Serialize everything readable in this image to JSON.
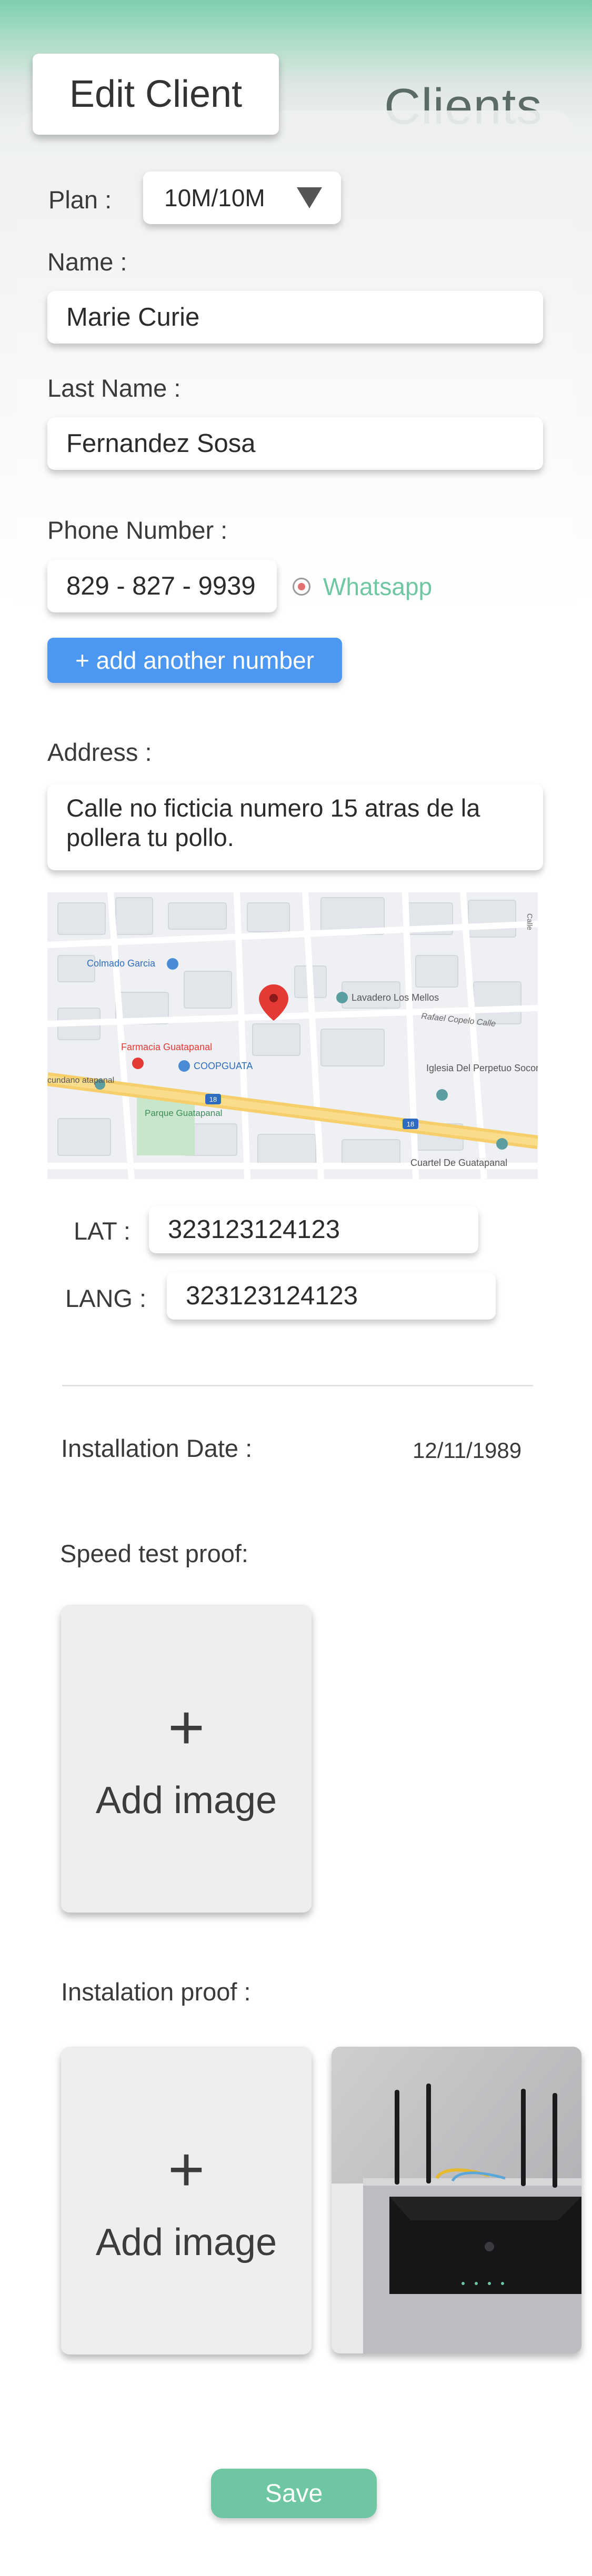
{
  "app": {
    "background_title": "Clients",
    "page_title": "Edit Client"
  },
  "plan": {
    "label": "Plan :",
    "value": "10M/10M"
  },
  "name": {
    "label": "Name :",
    "value": "Marie Curie"
  },
  "last_name": {
    "label": "Last Name :",
    "value": "Fernandez Sosa"
  },
  "phone": {
    "label": "Phone Number :",
    "value": "829 - 827 - 9939",
    "whatsapp_label": "Whatsapp",
    "add_button": "+ add another number"
  },
  "address": {
    "label": "Address :",
    "value": "Calle no ficticia numero 15 atras de la pollera tu pollo.",
    "map_labels": {
      "colmado": "Colmado Garcia",
      "lavadero": "Lavadero Los Mellos",
      "rafael": "Rafael Copelo Calle",
      "farmacia": "Farmacia Guatapanal",
      "coopguata": "COOPGUATA",
      "iglesia": "Iglesia Del Perpetuo Socorro",
      "parque": "Parque Guatapanal",
      "cuartel": "Cuartel De Guatapanal",
      "cundano": "cundano atapanal",
      "calle_side": "Calle",
      "route": "18"
    }
  },
  "coords": {
    "lat_label": "LAT :",
    "lat_value": "323123124123",
    "lang_label": "LANG :",
    "lang_value": "323123124123"
  },
  "installation": {
    "label": "Installation Date :",
    "date": "12/11/1989"
  },
  "speed_test": {
    "label": "Speed test proof:",
    "plus": "+",
    "add_image": "Add image"
  },
  "installation_proof": {
    "label": "Instalation proof :",
    "plus": "+",
    "add_image": "Add image"
  },
  "save_label": "Save",
  "colors": {
    "accent_green": "#6fc6a3",
    "button_blue": "#4c97f2",
    "map_pin": "#e53935"
  }
}
